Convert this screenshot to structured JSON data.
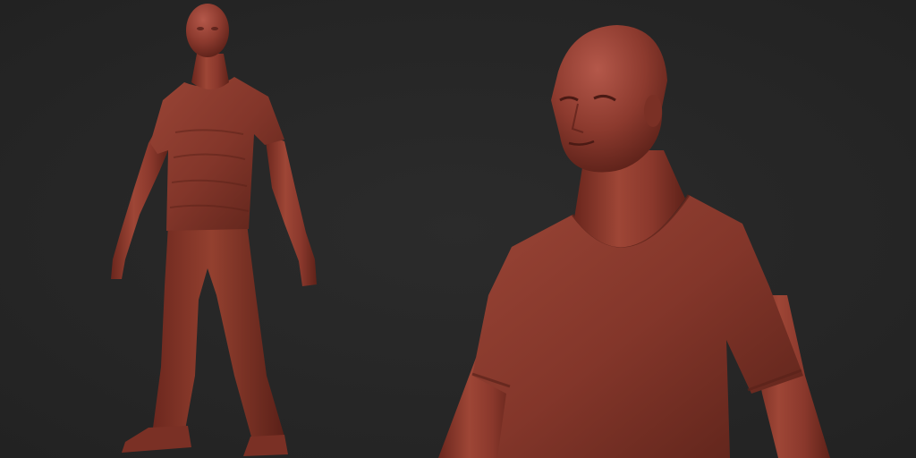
{
  "scene": {
    "background_color": "#272727",
    "material_color": "#8a3a2e",
    "material_highlight": "#b85a48",
    "material_shadow": "#4a1a14"
  },
  "views": [
    {
      "name": "full-body-view",
      "icon": "sculpt-figure"
    },
    {
      "name": "bust-closeup-view",
      "icon": "sculpt-bust"
    }
  ]
}
